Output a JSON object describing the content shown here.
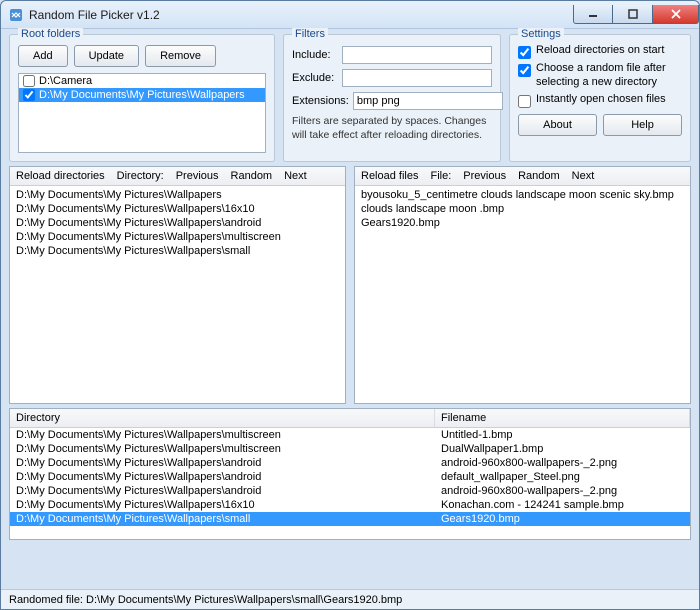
{
  "window": {
    "title": "Random File Picker v1.2"
  },
  "rootfolders": {
    "title": "Root folders",
    "buttons": {
      "add": "Add",
      "update": "Update",
      "remove": "Remove"
    },
    "items": [
      {
        "path": "D:\\Camera",
        "checked": false,
        "selected": false
      },
      {
        "path": "D:\\My Documents\\My Pictures\\Wallpapers",
        "checked": true,
        "selected": true
      }
    ]
  },
  "filters": {
    "title": "Filters",
    "include_label": "Include:",
    "include_value": "",
    "exclude_label": "Exclude:",
    "exclude_value": "",
    "extensions_label": "Extensions:",
    "extensions_value": "bmp png",
    "note": "Filters are separated by spaces. Changes will take effect after reloading directories."
  },
  "settings": {
    "title": "Settings",
    "reload_on_start": {
      "label": "Reload directories on start",
      "checked": true
    },
    "choose_after_select": {
      "label": "Choose a random file after selecting a new directory",
      "checked": true
    },
    "instant_open": {
      "label": "Instantly open chosen files",
      "checked": false
    },
    "about": "About",
    "help": "Help"
  },
  "dirpanel": {
    "head": {
      "reload": "Reload directories",
      "label": "Directory:",
      "prev": "Previous",
      "random": "Random",
      "next": "Next"
    },
    "rows": [
      "D:\\My Documents\\My Pictures\\Wallpapers",
      "D:\\My Documents\\My Pictures\\Wallpapers\\16x10",
      "D:\\My Documents\\My Pictures\\Wallpapers\\android",
      "D:\\My Documents\\My Pictures\\Wallpapers\\multiscreen",
      "D:\\My Documents\\My Pictures\\Wallpapers\\small"
    ]
  },
  "filepanel": {
    "head": {
      "reload": "Reload files",
      "label": "File:",
      "prev": "Previous",
      "random": "Random",
      "next": "Next"
    },
    "rows": [
      "byousoku_5_centimetre clouds landscape moon scenic sky.bmp",
      "clouds landscape moon .bmp",
      "Gears1920.bmp"
    ]
  },
  "table": {
    "headers": {
      "dir": "Directory",
      "fn": "Filename"
    },
    "rows": [
      {
        "dir": "D:\\My Documents\\My Pictures\\Wallpapers\\multiscreen",
        "fn": "Untitled-1.bmp",
        "selected": false
      },
      {
        "dir": "D:\\My Documents\\My Pictures\\Wallpapers\\multiscreen",
        "fn": "DualWallpaper1.bmp",
        "selected": false
      },
      {
        "dir": "D:\\My Documents\\My Pictures\\Wallpapers\\android",
        "fn": "android-960x800-wallpapers-_2.png",
        "selected": false
      },
      {
        "dir": "D:\\My Documents\\My Pictures\\Wallpapers\\android",
        "fn": "default_wallpaper_Steel.png",
        "selected": false
      },
      {
        "dir": "D:\\My Documents\\My Pictures\\Wallpapers\\android",
        "fn": "android-960x800-wallpapers-_2.png",
        "selected": false
      },
      {
        "dir": "D:\\My Documents\\My Pictures\\Wallpapers\\16x10",
        "fn": "Konachan.com - 124241 sample.bmp",
        "selected": false
      },
      {
        "dir": "D:\\My Documents\\My Pictures\\Wallpapers\\small",
        "fn": "Gears1920.bmp",
        "selected": true
      }
    ]
  },
  "status": "Randomed file: D:\\My Documents\\My Pictures\\Wallpapers\\small\\Gears1920.bmp"
}
